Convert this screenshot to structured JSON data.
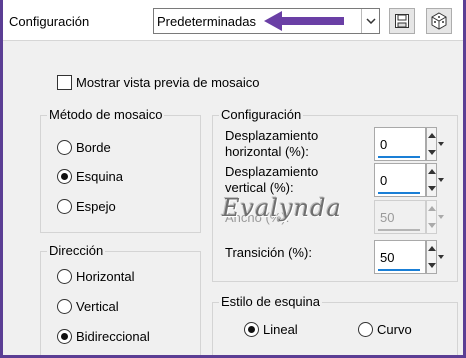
{
  "header": {
    "title": "Configuración",
    "preset_value": "Predeterminadas",
    "icons": [
      "chevron-down-icon",
      "save-icon",
      "dice-icon"
    ]
  },
  "options": {
    "preview_label": "Mostrar vista previa de mosaico",
    "preview_checked": false
  },
  "tile_method": {
    "legend": "Método de mosaico",
    "options": [
      "Borde",
      "Esquina",
      "Espejo"
    ],
    "selected": "Esquina"
  },
  "direction": {
    "legend": "Dirección",
    "options": [
      "Horizontal",
      "Vertical",
      "Bidireccional"
    ],
    "selected": "Bidireccional"
  },
  "settings": {
    "legend": "Configuración",
    "h_offset_label_1": "Desplazamiento",
    "h_offset_label_2": "horizontal (%):",
    "h_offset_value": "0",
    "v_offset_label_1": "Desplazamiento",
    "v_offset_label_2": "vertical (%):",
    "v_offset_value": "0",
    "width_label": "Ancho (%):",
    "width_value": "50",
    "transition_label": "Transición (%):",
    "transition_value": "50"
  },
  "corner_style": {
    "legend": "Estilo de esquina",
    "options": [
      "Lineal",
      "Curvo"
    ],
    "selected": "Lineal"
  },
  "watermark_text": "Evalynda",
  "colors": {
    "frame": "#5b3e94",
    "arrow": "#6a3fa5",
    "spin_bar": "#1a7fd6"
  }
}
